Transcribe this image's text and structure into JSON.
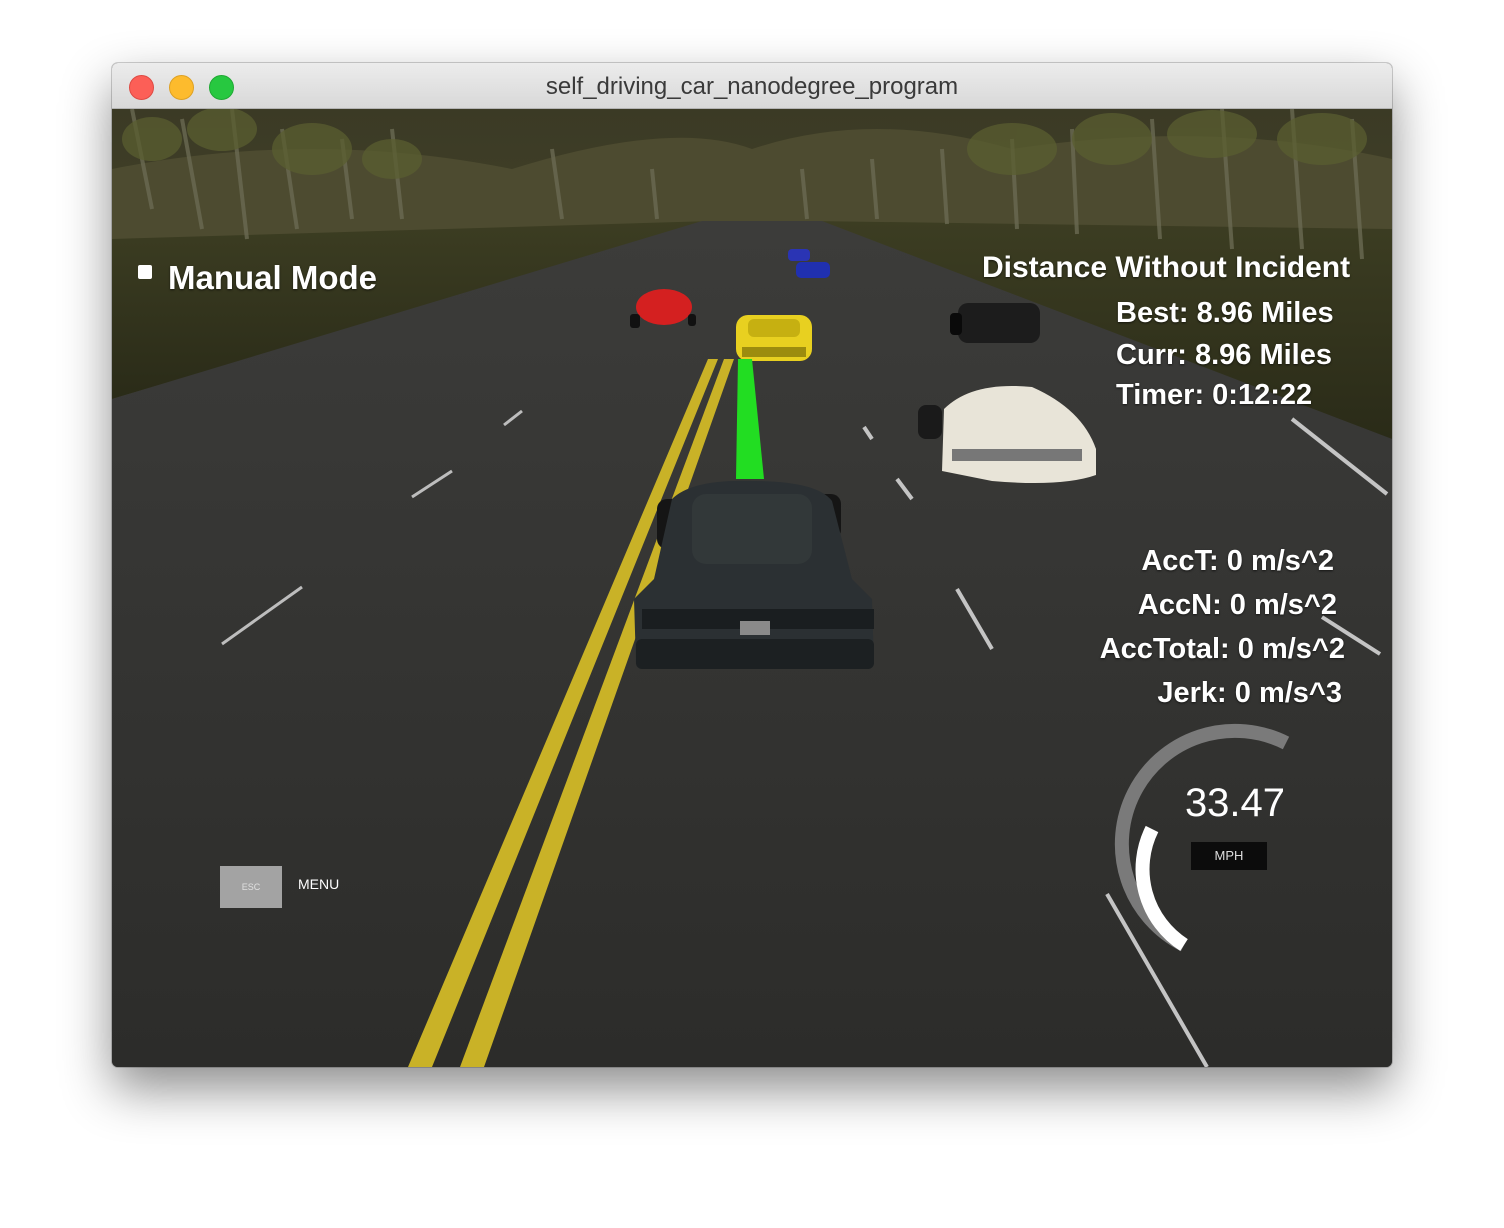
{
  "window": {
    "title": "self_driving_car_nanodegree_program"
  },
  "hud": {
    "mode_label": "Manual Mode",
    "distance_title": "Distance Without Incident",
    "best": "Best: 8.96 Miles",
    "curr": "Curr: 8.96 Miles",
    "timer": "Timer: 0:12:22",
    "acc_t": "AccT: 0 m/s^2",
    "acc_n": "AccN: 0 m/s^2",
    "acc_total": "AccTotal: 0 m/s^2",
    "jerk": "Jerk: 0 m/s^3"
  },
  "speedometer": {
    "value": "33.47",
    "unit": "MPH",
    "fill_fraction": 0.45
  },
  "controls": {
    "esc_key": "ESC",
    "menu_label": "MENU"
  },
  "colors": {
    "ego_car": "#2b3033",
    "path_line": "#22dd22",
    "lane_yellow": "#d8c02a",
    "car_red": "#d42020",
    "car_yellow": "#e8d020",
    "car_blue": "#2030b0",
    "car_black": "#1a1a1a",
    "car_white": "#e8e4d8"
  }
}
